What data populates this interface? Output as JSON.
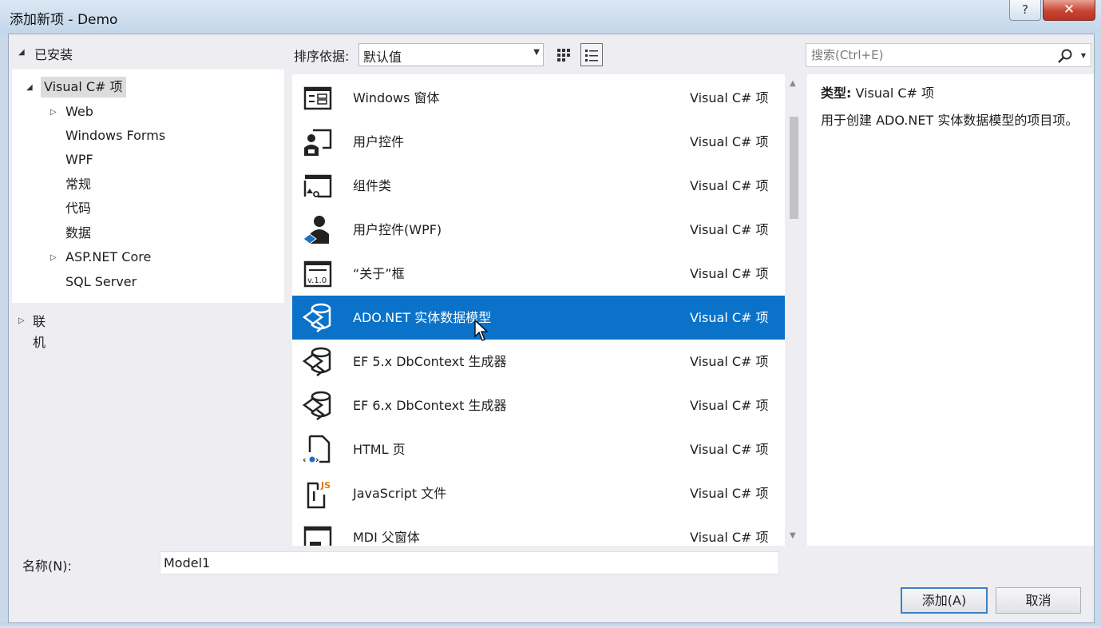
{
  "window": {
    "title": "添加新项 - Demo",
    "help_glyph": "?",
    "close_glyph": "✕"
  },
  "tree": {
    "installed_label": "已安装",
    "nodes": [
      {
        "label": "Visual C# 项",
        "expanded": true,
        "selected": true
      },
      {
        "label": "Web",
        "expandable": true
      },
      {
        "label": "Windows Forms"
      },
      {
        "label": "WPF"
      },
      {
        "label": "常规"
      },
      {
        "label": "代码"
      },
      {
        "label": "数据"
      },
      {
        "label": "ASP.NET Core",
        "expandable": true
      },
      {
        "label": "SQL Server"
      }
    ],
    "online_label": "联机"
  },
  "toolbar": {
    "sort_label": "排序依据:",
    "sort_value": "默认值",
    "view_modes": [
      "grid-view-icon",
      "list-view-icon"
    ],
    "active_view": "list-view-icon"
  },
  "search": {
    "placeholder": "搜索(Ctrl+E)"
  },
  "items": [
    {
      "name": "Windows 窗体",
      "category": "Visual C# 项",
      "icon": "windows-form-icon"
    },
    {
      "name": "用户控件",
      "category": "Visual C# 项",
      "icon": "user-control-icon"
    },
    {
      "name": "组件类",
      "category": "Visual C# 项",
      "icon": "component-class-icon"
    },
    {
      "name": "用户控件(WPF)",
      "category": "Visual C# 项",
      "icon": "wpf-user-control-icon"
    },
    {
      "name": "“关于”框",
      "category": "Visual C# 项",
      "icon": "about-box-icon"
    },
    {
      "name": "ADO.NET 实体数据模型",
      "category": "Visual C# 项",
      "icon": "entity-model-icon",
      "selected": true
    },
    {
      "name": "EF 5.x DbContext 生成器",
      "category": "Visual C# 项",
      "icon": "dbcontext-generator-icon"
    },
    {
      "name": "EF 6.x DbContext 生成器",
      "category": "Visual C# 项",
      "icon": "dbcontext-generator-icon"
    },
    {
      "name": "HTML 页",
      "category": "Visual C# 项",
      "icon": "html-page-icon"
    },
    {
      "name": "JavaScript 文件",
      "category": "Visual C# 项",
      "icon": "javascript-file-icon"
    },
    {
      "name": "MDI 父窗体",
      "category": "Visual C# 项",
      "icon": "mdi-parent-form-icon"
    }
  ],
  "about_icon_text": "v.1.0",
  "js_icon_text": "JS",
  "description": {
    "type_label": "类型:",
    "type_value": "Visual C# 项",
    "text": "用于创建 ADO.NET 实体数据模型的项目项。"
  },
  "footer": {
    "name_label": "名称(N):",
    "name_value": "Model1",
    "add_button": "添加(A)",
    "cancel_button": "取消"
  },
  "colors": {
    "selection": "#0b72c9",
    "accent_border": "#3c7fc2",
    "close_red": "#c74433"
  }
}
